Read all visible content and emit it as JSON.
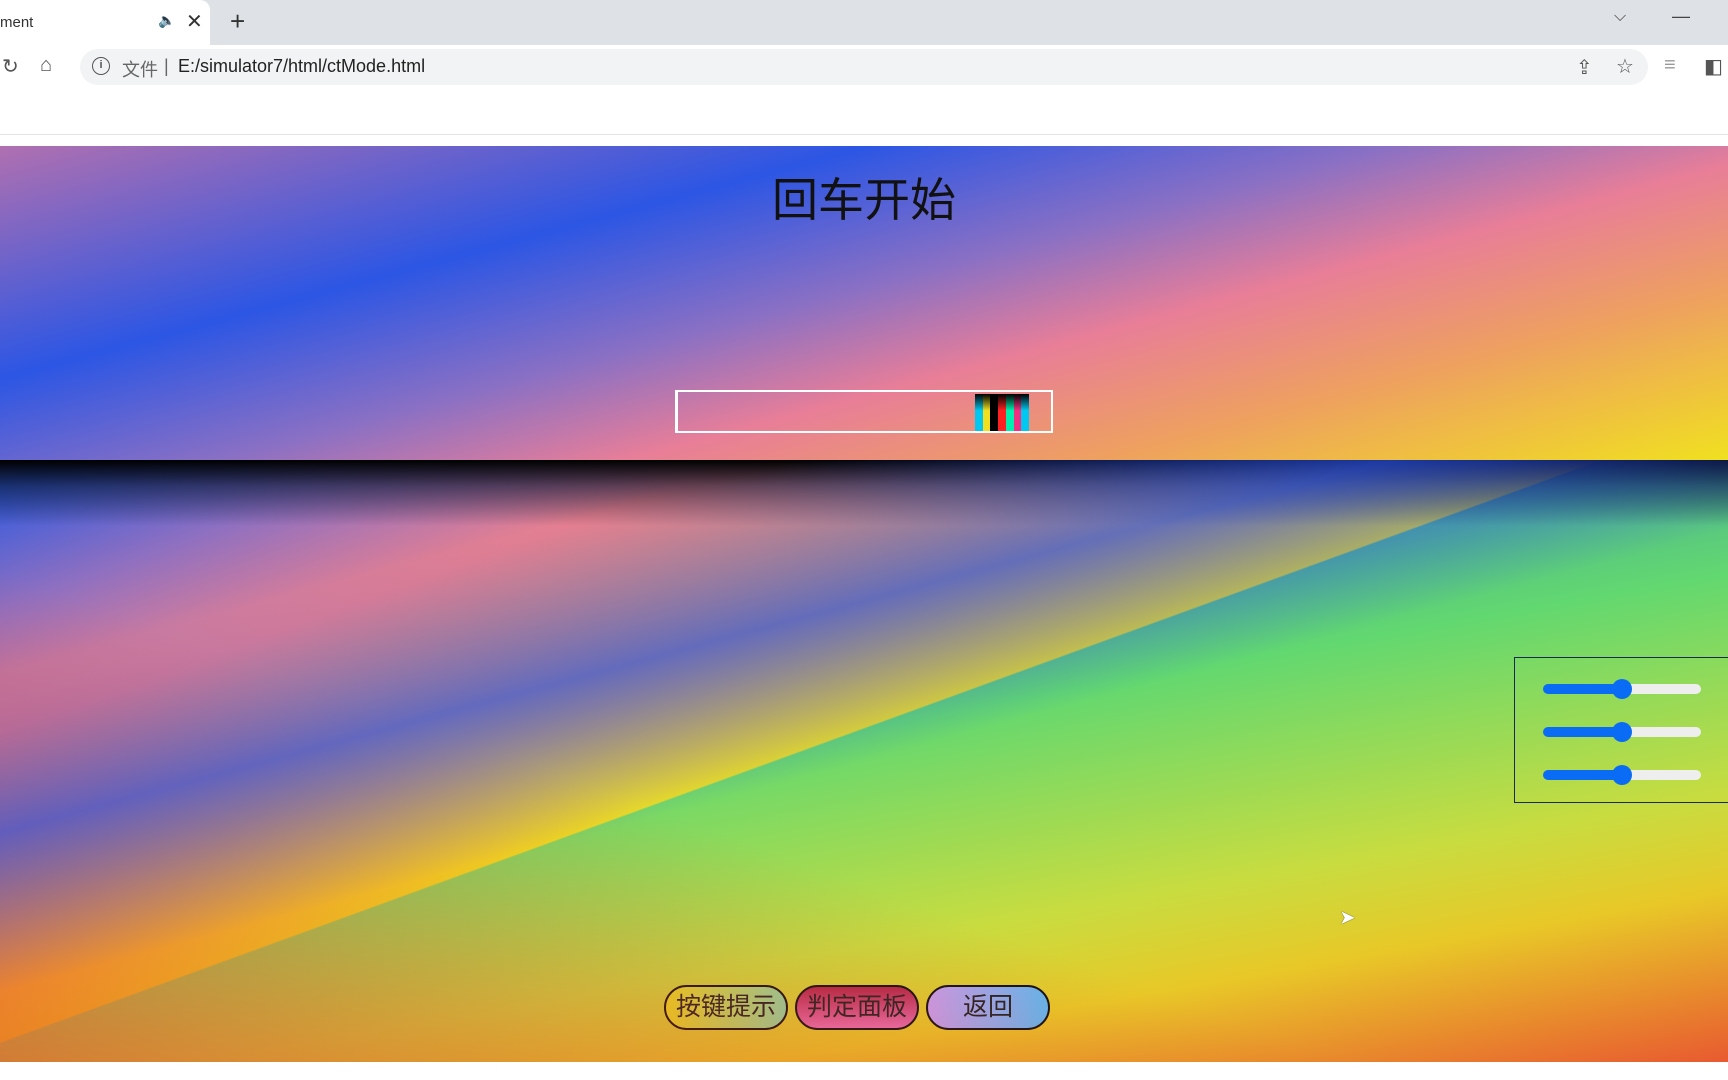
{
  "browser": {
    "tab_title": "ment",
    "url_scheme": "文件",
    "url": "E:/simulator7/html/ctMode.html",
    "icons": [
      "audio-icon",
      "close-icon",
      "plus-icon",
      "chevron-down-icon",
      "minimize-icon",
      "reload-icon",
      "home-icon",
      "info-icon",
      "share-icon",
      "star-icon",
      "media-icon",
      "sidepanel-icon"
    ]
  },
  "page": {
    "title": "回车开始",
    "progress_stripes": [
      "#00c8f0",
      "#f0e020",
      "#000000",
      "#ff2020",
      "#00f0b0",
      "#f03080",
      "#00c8f0"
    ],
    "sliders": [
      {
        "value": 50
      },
      {
        "value": 50
      },
      {
        "value": 50
      }
    ],
    "accent": "#0a6cf5",
    "buttons": {
      "hint": "按键提示",
      "judge": "判定面板",
      "back": "返回"
    }
  }
}
